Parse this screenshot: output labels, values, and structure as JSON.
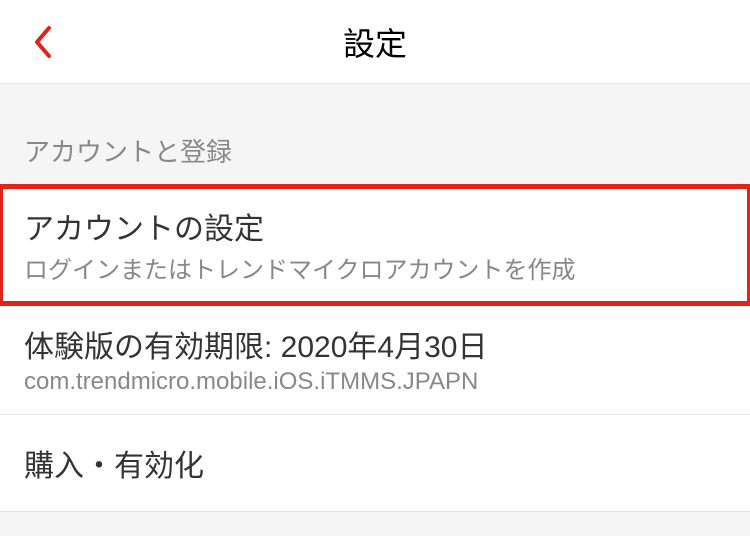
{
  "header": {
    "title": "設定"
  },
  "section": {
    "header": "アカウントと登録"
  },
  "items": [
    {
      "title": "アカウントの設定",
      "subtitle": "ログインまたはトレンドマイクロアカウントを作成"
    },
    {
      "title": "体験版の有効期限: 2020年4月30日",
      "subtitle": "com.trendmicro.mobile.iOS.iTMMS.JPAPN"
    },
    {
      "title": "購入・有効化"
    }
  ]
}
